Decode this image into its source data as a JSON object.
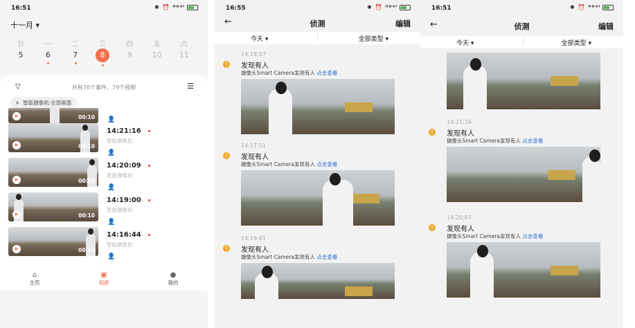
{
  "screen1": {
    "status_time": "16:51",
    "status_icons": "✱ ⏰ ᴴᴰ⁴ˡ",
    "month_label": "十一月",
    "weekdays": [
      "日",
      "一",
      "二",
      "三",
      "四",
      "五",
      "六"
    ],
    "days": [
      "5",
      "6",
      "7",
      "8",
      "9",
      "10",
      "11"
    ],
    "summary": "共有70个事件、79个视频",
    "filter_chip": "智能摄像机-全部画面",
    "chip_close": "×",
    "events": [
      {
        "time": "",
        "source": "",
        "duration": "00:10"
      },
      {
        "time": "14:21:16",
        "source": "智能摄像机",
        "duration": "00:10"
      },
      {
        "time": "14:20:09",
        "source": "智能摄像机",
        "duration": "00:10"
      },
      {
        "time": "14:19:00",
        "source": "智能摄像机",
        "duration": "00:10"
      },
      {
        "time": "14:16:44",
        "source": "智能摄像机",
        "duration": "00:10"
      }
    ],
    "tabs": [
      {
        "label": "主页",
        "icon": "home-icon"
      },
      {
        "label": "相册",
        "icon": "album-icon"
      },
      {
        "label": "我的",
        "icon": "profile-icon"
      }
    ]
  },
  "screen2": {
    "status_time": "16:55",
    "status_icons": "✱ ⏰ ᴴᴰ⁴ˡ",
    "title": "侦测",
    "edit": "编辑",
    "filter_date": "今天",
    "filter_type": "全部类型",
    "entries": [
      {
        "time": "14:18:57",
        "title": "发现有人",
        "desc": "摄像头Smart Camera发现有人",
        "link": "点击查看"
      },
      {
        "time": "14:17:51",
        "title": "发现有人",
        "desc": "摄像头Smart Camera发现有人",
        "link": "点击查看"
      },
      {
        "time": "14:16:41",
        "title": "发现有人",
        "desc": "摄像头Smart Camera发现有人",
        "link": "点击查看"
      }
    ]
  },
  "screen3": {
    "status_time": "16:51",
    "status_icons": "✱ ⏰ ᴴᴰ⁴ˡ",
    "title": "侦测",
    "edit": "编辑",
    "filter_date": "今天",
    "filter_type": "全部类型",
    "entries": [
      {
        "time": "",
        "title": "",
        "desc": "",
        "link": ""
      },
      {
        "time": "14:21:16",
        "title": "发现有人",
        "desc": "摄像头Smart Camera发现有人",
        "link": "点击查看"
      },
      {
        "time": "14:20:07",
        "title": "发现有人",
        "desc": "摄像头Smart Camera发现有人",
        "link": "点击查看"
      }
    ]
  },
  "colors": {
    "accent": "#f0714d",
    "link": "#2f6fd1",
    "warning": "#f5a623"
  }
}
